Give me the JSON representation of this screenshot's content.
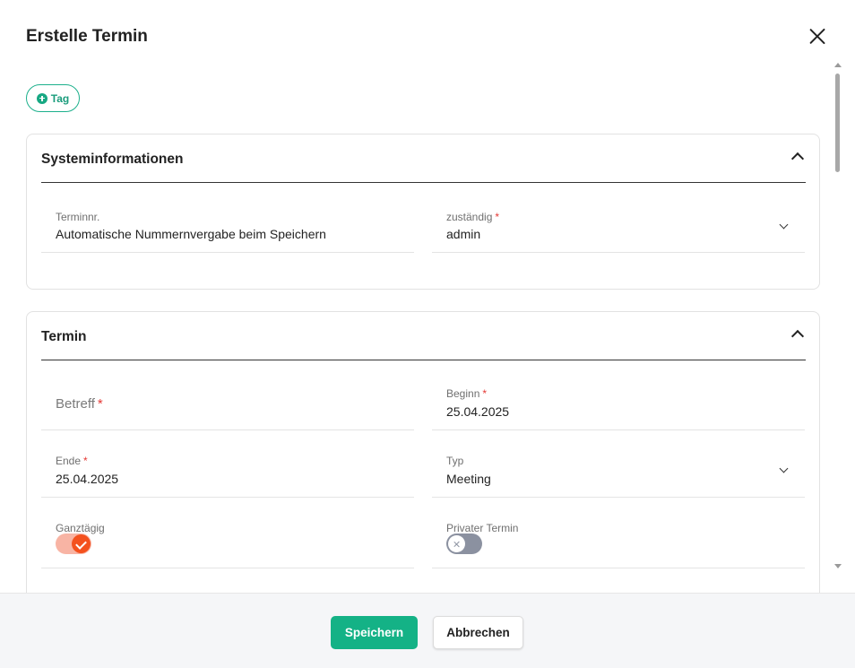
{
  "dialog": {
    "title": "Erstelle Termin"
  },
  "tag_button": {
    "label": "Tag"
  },
  "systeminfo": {
    "title": "Systeminformationen",
    "terminnr": {
      "label": "Terminnr.",
      "value": "Automatische Nummernvergabe beim Speichern"
    },
    "zustaendig": {
      "label": "zuständig",
      "required": "*",
      "value": "admin"
    }
  },
  "termin": {
    "title": "Termin",
    "betreff": {
      "placeholder": "Betreff",
      "required": "*"
    },
    "beginn": {
      "label": "Beginn",
      "required": "*",
      "value": "25.04.2025"
    },
    "ende": {
      "label": "Ende",
      "required": "*",
      "value": "25.04.2025"
    },
    "typ": {
      "label": "Typ",
      "value": "Meeting"
    },
    "ganztaegig": {
      "label": "Ganztägig",
      "checked": true
    },
    "privat": {
      "label": "Privater Termin",
      "checked": false
    }
  },
  "footer": {
    "save_label": "Speichern",
    "cancel_label": "Abbrechen"
  },
  "colors": {
    "accent": "#14b286",
    "toggle_on": "#f4511e",
    "required": "#e53935"
  }
}
